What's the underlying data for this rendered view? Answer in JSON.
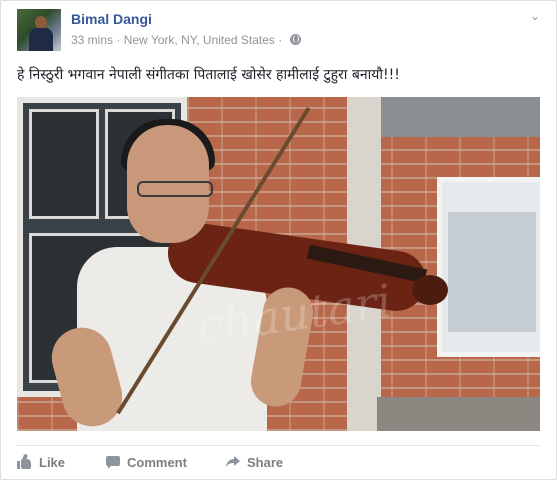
{
  "post": {
    "author": "Bimal Dangi",
    "time": "33 mins",
    "separator": "·",
    "location": "New York, NY, United States",
    "separator2": "·",
    "privacy_icon": "globe-icon",
    "menu_icon": "chevron-down-icon",
    "text": "हे निस्ठुरी भगवान नेपाली संगीतका पितालाई खोसेर हामीलाई टुहुरा बनायौ!!!",
    "photo": {
      "description": "photo-man-playing-violin",
      "watermark": "chautari"
    }
  },
  "actions": {
    "like_label": "Like",
    "comment_label": "Comment",
    "share_label": "Share"
  },
  "colors": {
    "author_link": "#365899",
    "meta_text": "#90949c",
    "action_text": "#7f7f7f"
  }
}
